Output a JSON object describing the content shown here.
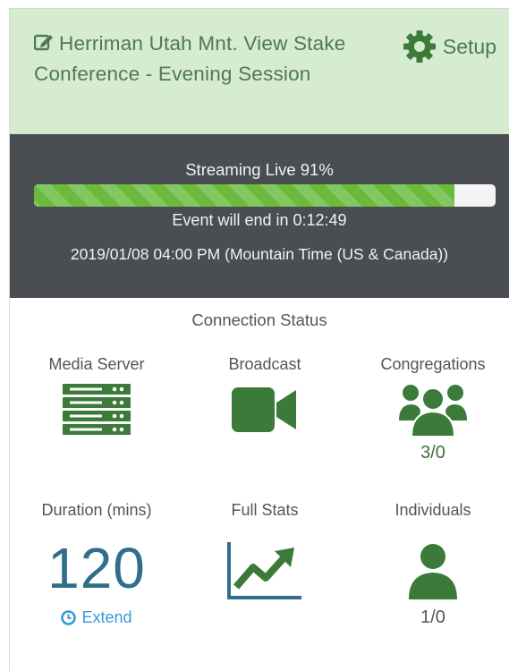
{
  "header": {
    "title": "Herriman Utah Mnt. View Stake Conference - Evening Session",
    "setup_label": "Setup"
  },
  "banner": {
    "streaming_label": "Streaming Live 91%",
    "progress_fraction": 0.91,
    "ends_in": "Event will end in 0:12:49",
    "datetime": "2019/01/08 04:00 PM (Mountain Time (US & Canada))"
  },
  "connection": {
    "title": "Connection Status",
    "media_server": {
      "label": "Media Server",
      "icon": "server-icon"
    },
    "broadcast": {
      "label": "Broadcast",
      "icon": "video-camera-icon"
    },
    "congregations": {
      "label": "Congregations",
      "icon": "users-group-icon",
      "value": "3/0"
    },
    "duration": {
      "label": "Duration (mins)",
      "value": "120",
      "extend_label": "Extend"
    },
    "full_stats": {
      "label": "Full Stats",
      "icon": "line-chart-icon"
    },
    "individuals": {
      "label": "Individuals",
      "icon": "user-icon",
      "value": "1/0"
    }
  },
  "colors": {
    "header_bg": "#d5ecd0",
    "banner_bg": "#4a4d52",
    "progress_green": "#69bb3e",
    "icon_green": "#3c7a3a",
    "duration_blue": "#2f6f8a",
    "link_blue": "#3a9ad9"
  }
}
